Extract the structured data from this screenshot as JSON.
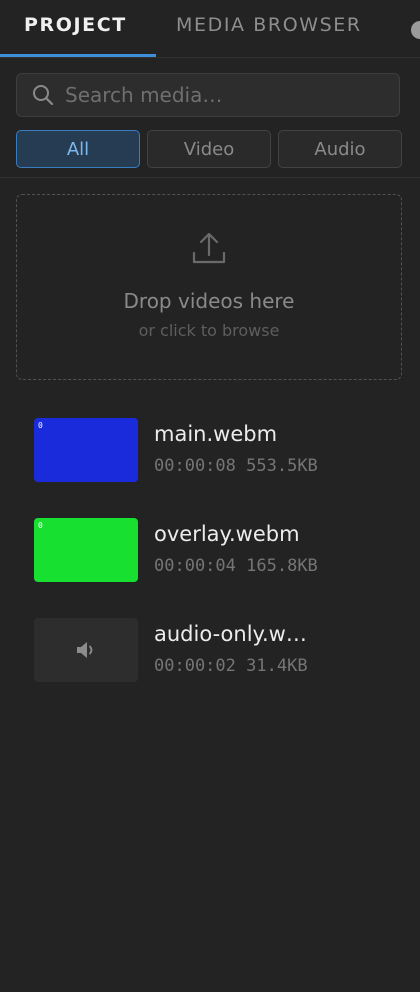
{
  "tabs": {
    "project": "PROJECT",
    "media_browser": "MEDIA BROWSER"
  },
  "search": {
    "placeholder": "Search media…",
    "value": ""
  },
  "filters": {
    "active": "All",
    "options": [
      "All",
      "Video",
      "Audio"
    ]
  },
  "dropzone": {
    "title": "Drop videos here",
    "subtitle": "or click to browse",
    "icon": "upload-icon"
  },
  "media": [
    {
      "name": "main.webm",
      "duration": "00:00:08",
      "size": "553.5KB",
      "type": "video",
      "thumb_label": "0",
      "thumb_color": "#1a2bdc"
    },
    {
      "name": "overlay.webm",
      "duration": "00:00:04",
      "size": "165.8KB",
      "type": "video",
      "thumb_label": "0",
      "thumb_color": "#18e030"
    },
    {
      "name": "audio-only.w…",
      "duration": "00:00:02",
      "size": "31.4KB",
      "type": "audio",
      "thumb_icon": "speaker-icon"
    }
  ],
  "colors": {
    "accent": "#3f8ed9",
    "background": "#232323",
    "active_filter_bg": "#263c52"
  }
}
